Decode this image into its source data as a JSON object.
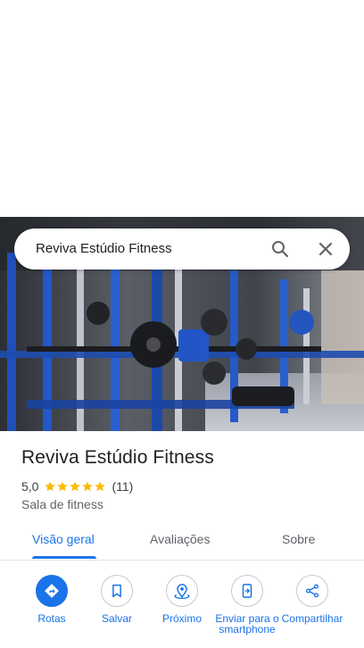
{
  "search": {
    "query": "Reviva Estúdio Fitness"
  },
  "place": {
    "name": "Reviva Estúdio Fitness",
    "rating": "5,0",
    "stars": 5,
    "reviews_count": "(11)",
    "category": "Sala de fitness"
  },
  "tabs": [
    {
      "label": "Visão geral",
      "active": true
    },
    {
      "label": "Avaliações",
      "active": false
    },
    {
      "label": "Sobre",
      "active": false
    }
  ],
  "actions": [
    {
      "label": "Rotas",
      "icon": "directions-icon"
    },
    {
      "label": "Salvar",
      "icon": "bookmark-icon"
    },
    {
      "label": "Próximo",
      "icon": "nearby-icon"
    },
    {
      "label": "Enviar para o smartphone",
      "icon": "send-to-phone-icon"
    },
    {
      "label": "Compartilhar",
      "icon": "share-icon"
    }
  ],
  "colors": {
    "accent": "#1a73e8",
    "star": "#fbbc04",
    "text": "#202124",
    "secondary_text": "#5f6368"
  }
}
